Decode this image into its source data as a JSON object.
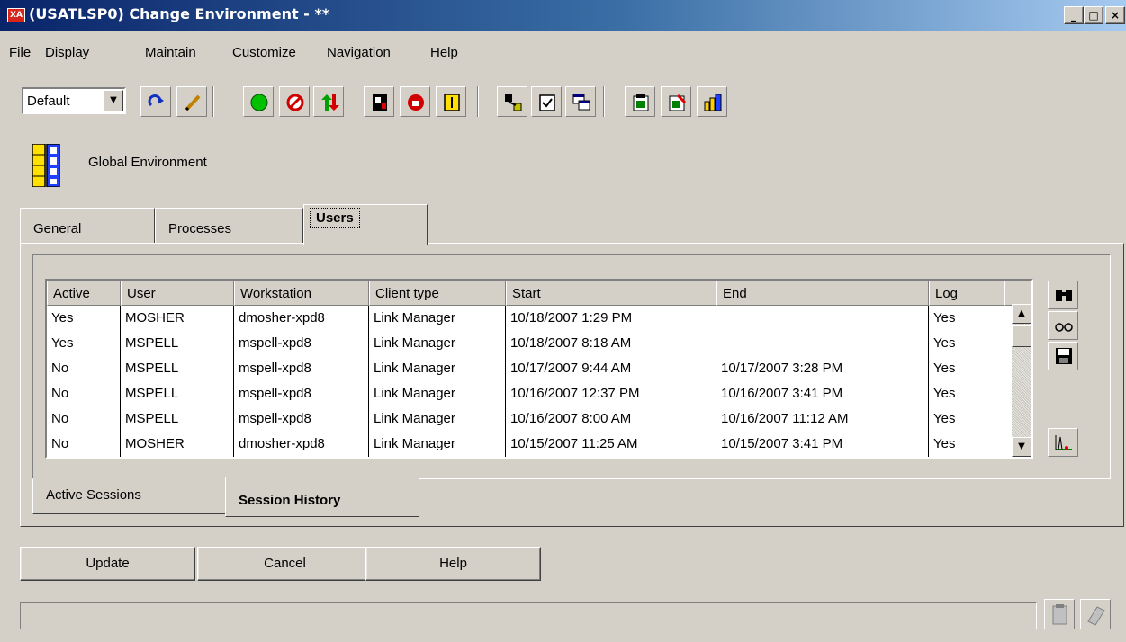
{
  "window": {
    "app_icon_text": "XA",
    "title": "(USATLSP0) Change Environment - **",
    "min_glyph": "_",
    "max_glyph": "□",
    "close_glyph": "×"
  },
  "menu": [
    "File",
    "Display",
    "Maintain",
    "Customize",
    "Navigation",
    "Help"
  ],
  "toolbar": {
    "view_select": "Default",
    "buttons": [
      "refresh-icon",
      "edit-pencil-icon",
      "start-green-icon",
      "stop-icon",
      "transfer-arrows-icon",
      "print-icon",
      "lock-record-icon",
      "document-icon",
      "users-link-icon",
      "checklist-icon",
      "windows-icon",
      "report-icon",
      "report-edit-icon",
      "environment-grid-icon"
    ]
  },
  "header": {
    "title": "Global Environment"
  },
  "tabs": [
    {
      "label": "General",
      "active": false
    },
    {
      "label": "Processes",
      "active": false
    },
    {
      "label": "Users",
      "active": true
    }
  ],
  "table": {
    "columns": [
      "Active",
      "User",
      "Workstation",
      "Client type",
      "Start",
      "End",
      "Log"
    ],
    "rows": [
      [
        "Yes",
        "MOSHER",
        "dmosher-xpd8",
        "Link Manager",
        "10/18/2007 1:29 PM",
        "",
        "Yes"
      ],
      [
        "Yes",
        "MSPELL",
        "mspell-xpd8",
        "Link Manager",
        "10/18/2007 8:18 AM",
        "",
        "Yes"
      ],
      [
        "No",
        "MSPELL",
        "mspell-xpd8",
        "Link Manager",
        "10/17/2007 9:44 AM",
        "10/17/2007 3:28 PM",
        "Yes"
      ],
      [
        "No",
        "MSPELL",
        "mspell-xpd8",
        "Link Manager",
        "10/16/2007 12:37 PM",
        "10/16/2007 3:41 PM",
        "Yes"
      ],
      [
        "No",
        "MSPELL",
        "mspell-xpd8",
        "Link Manager",
        "10/16/2007 8:00 AM",
        "10/16/2007 11:12 AM",
        "Yes"
      ],
      [
        "No",
        "MOSHER",
        "dmosher-xpd8",
        "Link Manager",
        "10/15/2007 11:25 AM",
        "10/15/2007 3:41 PM",
        "Yes"
      ]
    ]
  },
  "session_tabs": [
    {
      "label": "Active Sessions",
      "active": false
    },
    {
      "label": "Session History",
      "active": true
    }
  ],
  "buttons": {
    "update": "Update",
    "cancel": "Cancel",
    "help": "Help"
  }
}
